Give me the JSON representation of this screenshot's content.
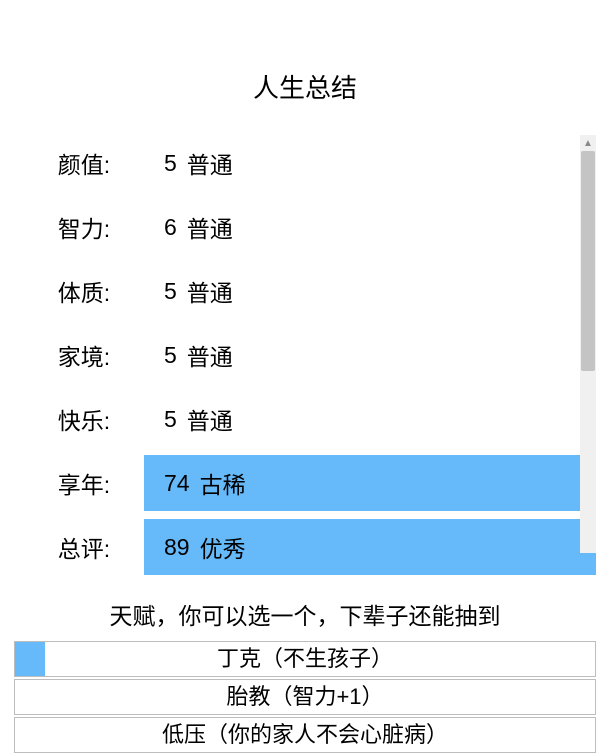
{
  "title": "人生总结",
  "stats": [
    {
      "label": "颜值:",
      "value": "5",
      "grade": "普通",
      "hl": false
    },
    {
      "label": "智力:",
      "value": "6",
      "grade": "普通",
      "hl": false
    },
    {
      "label": "体质:",
      "value": "5",
      "grade": "普通",
      "hl": false
    },
    {
      "label": "家境:",
      "value": "5",
      "grade": "普通",
      "hl": false
    },
    {
      "label": "快乐:",
      "value": "5",
      "grade": "普通",
      "hl": false
    },
    {
      "label": "享年:",
      "value": "74",
      "grade": "古稀",
      "hl": true
    },
    {
      "label": "总评:",
      "value": "89",
      "grade": "优秀",
      "hl": true
    }
  ],
  "talent_header": "天赋，你可以选一个，下辈子还能抽到",
  "talents": [
    {
      "label": "丁克（不生孩子）",
      "selected": true
    },
    {
      "label": "胎教（智力+1）",
      "selected": false
    },
    {
      "label": "低压（你的家人不会心脏病）",
      "selected": false
    }
  ]
}
